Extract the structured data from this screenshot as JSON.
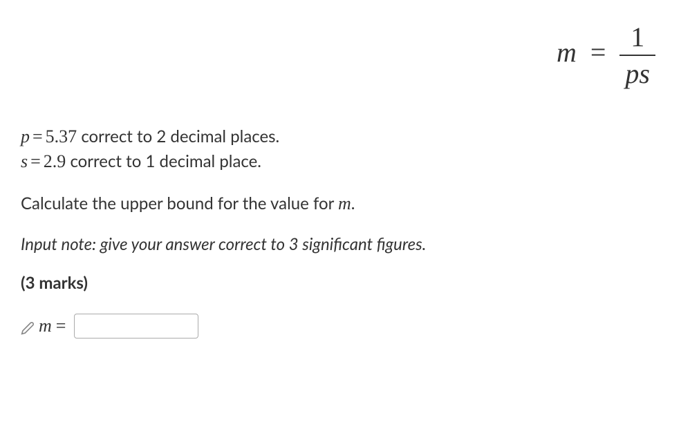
{
  "formula": {
    "lhs": "m",
    "eq": "=",
    "numerator": "1",
    "denominator": "ps"
  },
  "given": {
    "p_var": "p",
    "p_eq": "=",
    "p_val": "5.37",
    "p_text": " correct to 2 decimal places.",
    "s_var": "s",
    "s_eq": "=",
    "s_val": "2.9",
    "s_text": " correct to 1 decimal place."
  },
  "question": {
    "prefix": "Calculate the upper bound for the value for ",
    "var": "m",
    "suffix": "."
  },
  "input_note": "Input note: give your answer correct to 3 significant figures.",
  "marks": "(3 marks)",
  "answer": {
    "var": "m",
    "eq": "=",
    "placeholder": ""
  }
}
